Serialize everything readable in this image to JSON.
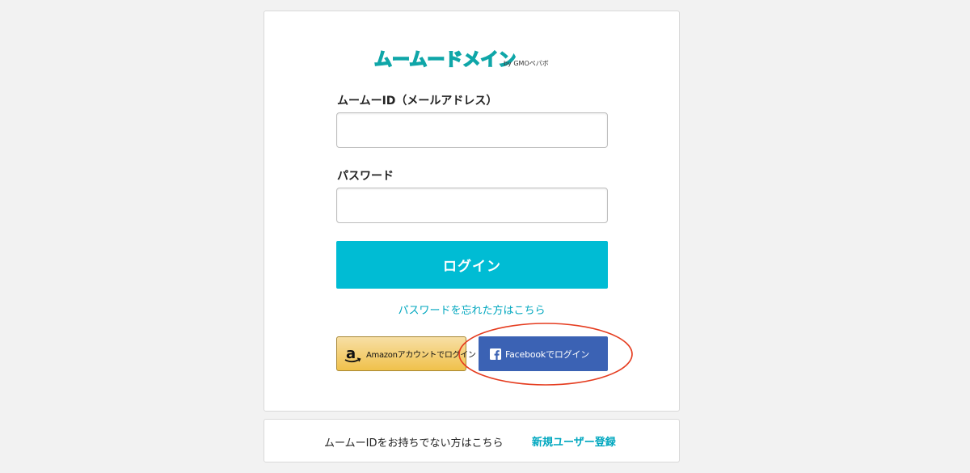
{
  "brand": {
    "logo_text": "ムームードメイン",
    "logo_sub": "by GMOペパボ",
    "logo_color": "#0fa6a8"
  },
  "form": {
    "id_label": "ムームーID（メールアドレス）",
    "id_value": "",
    "password_label": "パスワード",
    "password_value": "",
    "login_button": "ログイン",
    "forgot_link": "パスワードを忘れた方はこちら"
  },
  "social": {
    "amazon_label": "Amazonアカウントでログイン",
    "amazon_icon": "amazon-icon",
    "facebook_label": "Facebookでログイン",
    "facebook_icon": "facebook-icon"
  },
  "footer": {
    "prompt": "ムームーIDをお持ちでない方はこちら",
    "register_link": "新規ユーザー登録"
  },
  "colors": {
    "accent": "#00bcd4",
    "link": "#00a7bf",
    "facebook": "#3b62b4",
    "amazon": "#f0c14b",
    "annotation": "#e53c1f"
  }
}
